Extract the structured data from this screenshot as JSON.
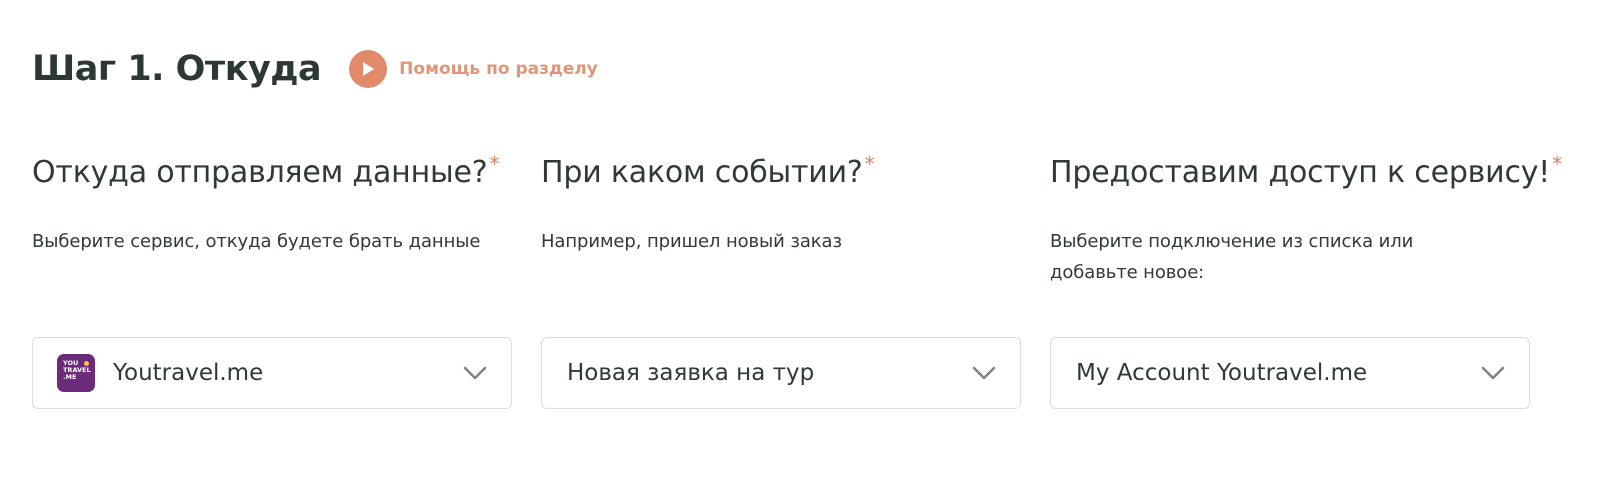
{
  "header": {
    "title": "Шаг 1. Откуда",
    "help_label": "Помощь по разделу"
  },
  "columns": [
    {
      "title": "Откуда отправляем данные?",
      "required_mark": "*",
      "description": "Выберите сервис, откуда будете брать данные",
      "select": {
        "value": "Youtravel.me",
        "icon": "youtravel-logo-icon",
        "logo_lines": [
          "YOU",
          "TRAVEL",
          ".ME"
        ]
      }
    },
    {
      "title": "При каком событии?",
      "required_mark": "*",
      "description": "Например, пришел новый заказ",
      "select": {
        "value": "Новая заявка на тур"
      }
    },
    {
      "title": "Предоставим доступ к сервису!",
      "required_mark": "*",
      "description": "Выберите подключение из списка или добавьте новое:",
      "select": {
        "value": "My Account Youtravel.me"
      }
    }
  ],
  "colors": {
    "accent": "#e08a6a",
    "text": "#2f3a34",
    "border": "#dcdcdc",
    "logo_bg": "#6c2a7a"
  }
}
